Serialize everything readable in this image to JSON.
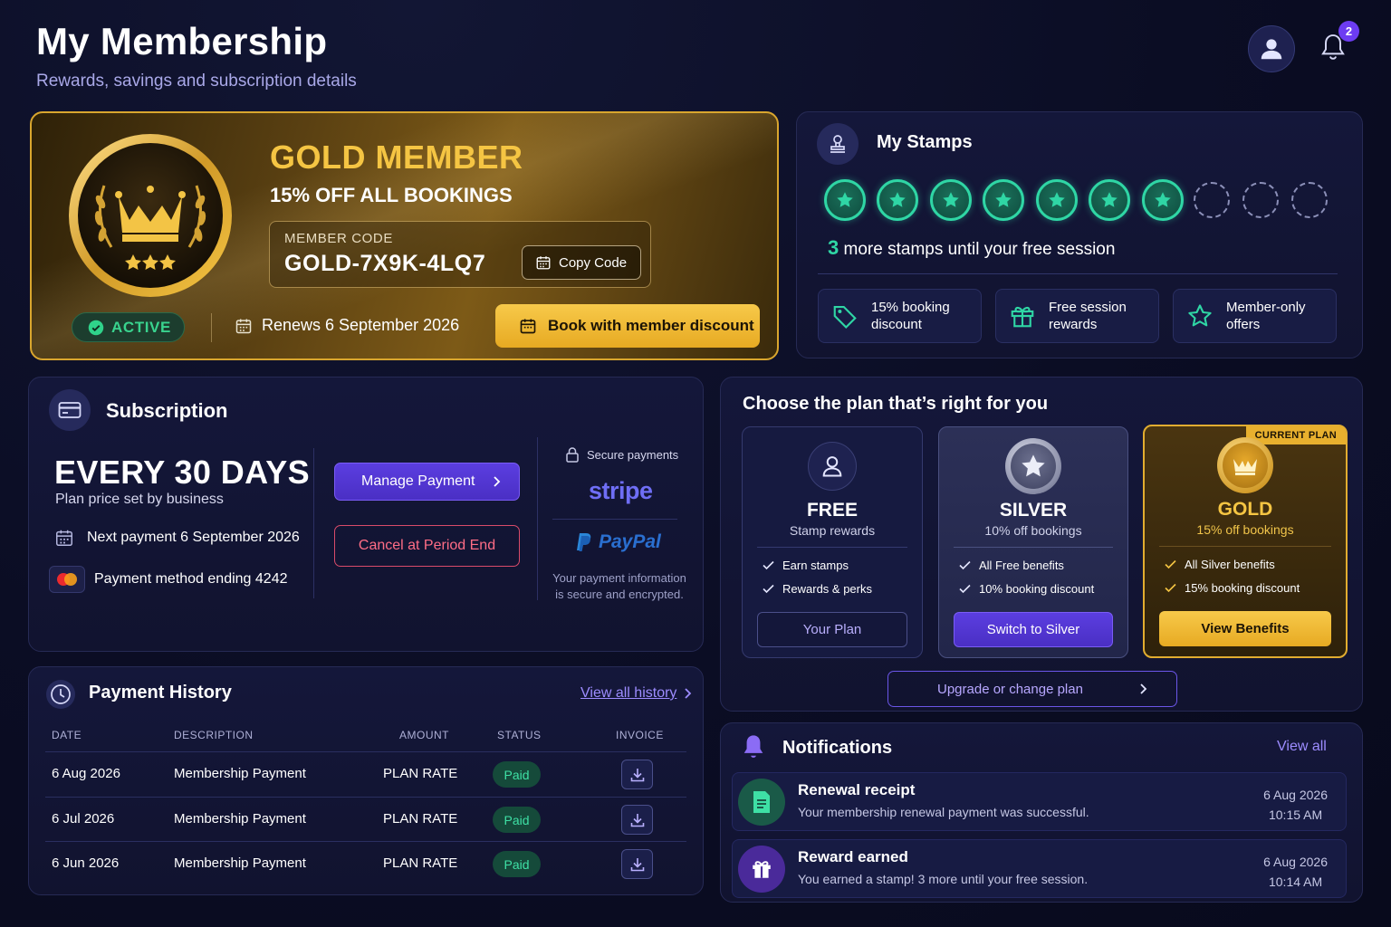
{
  "header": {
    "title": "My Membership",
    "subtitle": "Rewards, savings and subscription details",
    "notification_count": "2"
  },
  "gold_card": {
    "title": "GOLD MEMBER",
    "discount": "15% OFF ALL BOOKINGS",
    "code_label": "MEMBER CODE",
    "code_value": "GOLD-7X9K-4LQ7",
    "copy_label": "Copy Code",
    "status": "ACTIVE",
    "renews": "Renews 6 September 2026",
    "book_label": "Book with member discount"
  },
  "stamps": {
    "title": "My Stamps",
    "total": 10,
    "filled": 7,
    "remaining_count": "3",
    "remaining_text": "more stamps until your free session",
    "perks": [
      {
        "label": "15% booking discount",
        "icon": "tag-icon"
      },
      {
        "label": "Free session rewards",
        "icon": "gift-icon"
      },
      {
        "label": "Member-only offers",
        "icon": "star-icon"
      }
    ]
  },
  "subscription": {
    "title": "Subscription",
    "frequency": "EVERY 30 DAYS",
    "price_note": "Plan price set by business",
    "next_payment": "Next payment 6 September 2026",
    "payment_method": "Payment method ending 4242",
    "manage_label": "Manage Payment",
    "cancel_label": "Cancel at Period End",
    "secure_label": "Secure payments",
    "stripe_label": "stripe",
    "paypal_label": "PayPal",
    "secure_note": "Your payment information is secure and encrypted."
  },
  "plans": {
    "title": "Choose the plan that’s right for you",
    "items": [
      {
        "name": "FREE",
        "subtitle": "Stamp rewards",
        "features": [
          "Earn stamps",
          "Rewards & perks"
        ],
        "button": "Your Plan"
      },
      {
        "name": "SILVER",
        "subtitle": "10% off bookings",
        "features": [
          "All Free benefits",
          "10% booking discount"
        ],
        "button": "Switch to Silver"
      },
      {
        "name": "GOLD",
        "subtitle": "15% off bookings",
        "features": [
          "All Silver benefits",
          "15% booking discount"
        ],
        "button": "View Benefits",
        "badge": "CURRENT PLAN"
      }
    ],
    "upgrade_label": "Upgrade or change plan"
  },
  "history": {
    "title": "Payment History",
    "view_all": "View all history",
    "columns": [
      "DATE",
      "DESCRIPTION",
      "AMOUNT",
      "STATUS",
      "INVOICE"
    ],
    "rows": [
      {
        "date": "6 Aug 2026",
        "description": "Membership Payment",
        "amount": "PLAN RATE",
        "status": "Paid"
      },
      {
        "date": "6 Jul 2026",
        "description": "Membership Payment",
        "amount": "PLAN RATE",
        "status": "Paid"
      },
      {
        "date": "6 Jun 2026",
        "description": "Membership Payment",
        "amount": "PLAN RATE",
        "status": "Paid"
      }
    ]
  },
  "notifications": {
    "title": "Notifications",
    "view_all": "View all",
    "items": [
      {
        "title": "Renewal receipt",
        "desc": "Your membership renewal payment was successful.",
        "date": "6 Aug 2026",
        "time": "10:15 AM"
      },
      {
        "title": "Reward earned",
        "desc": "You earned a stamp! 3 more until your free session.",
        "date": "6 Aug 2026",
        "time": "10:14 AM"
      }
    ]
  },
  "colors": {
    "accent": "#6d3cf2",
    "gold": "#f5c543",
    "stamp_green": "#2fd6a5",
    "paid_green": "#3ee0a5",
    "cancel_red": "#ff6d86"
  }
}
